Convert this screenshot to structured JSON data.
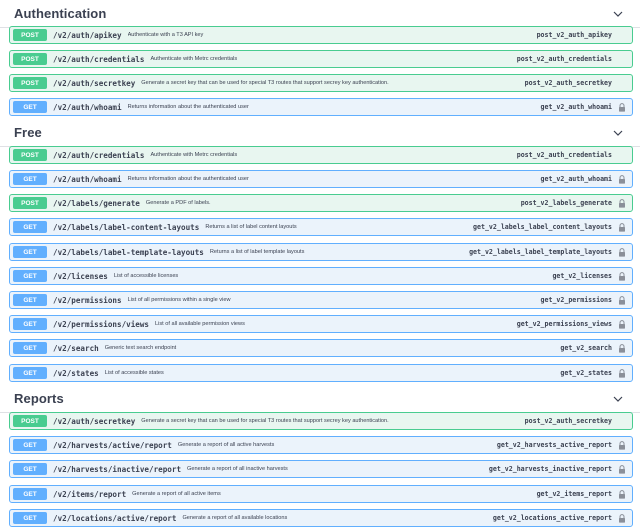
{
  "sections": [
    {
      "title": "Authentication",
      "operations": [
        {
          "method": "POST",
          "path": "/v2/auth/apikey",
          "summary": "Authenticate with a T3 API key",
          "operation_id": "post_v2_auth_apikey",
          "locked": false
        },
        {
          "method": "POST",
          "path": "/v2/auth/credentials",
          "summary": "Authenticate with Metrc credentials",
          "operation_id": "post_v2_auth_credentials",
          "locked": false
        },
        {
          "method": "POST",
          "path": "/v2/auth/secretkey",
          "summary": "Generate a secret key that can be used for special T3 routes that support secrey key authentication.",
          "operation_id": "post_v2_auth_secretkey",
          "locked": false
        },
        {
          "method": "GET",
          "path": "/v2/auth/whoami",
          "summary": "Returns information about the authenticated user",
          "operation_id": "get_v2_auth_whoami",
          "locked": true
        }
      ]
    },
    {
      "title": "Free",
      "operations": [
        {
          "method": "POST",
          "path": "/v2/auth/credentials",
          "summary": "Authenticate with Metrc credentials",
          "operation_id": "post_v2_auth_credentials",
          "locked": false
        },
        {
          "method": "GET",
          "path": "/v2/auth/whoami",
          "summary": "Returns information about the authenticated user",
          "operation_id": "get_v2_auth_whoami",
          "locked": true
        },
        {
          "method": "POST",
          "path": "/v2/labels/generate",
          "summary": "Generate a PDF of labels.",
          "operation_id": "post_v2_labels_generate",
          "locked": true
        },
        {
          "method": "GET",
          "path": "/v2/labels/label-content-layouts",
          "summary": "Returns a list of label content layouts",
          "operation_id": "get_v2_labels_label_content_layouts",
          "locked": true
        },
        {
          "method": "GET",
          "path": "/v2/labels/label-template-layouts",
          "summary": "Returns a list of label template layouts",
          "operation_id": "get_v2_labels_label_template_layouts",
          "locked": true
        },
        {
          "method": "GET",
          "path": "/v2/licenses",
          "summary": "List of accessible licenses",
          "operation_id": "get_v2_licenses",
          "locked": true
        },
        {
          "method": "GET",
          "path": "/v2/permissions",
          "summary": "List of all permissions within a single view",
          "operation_id": "get_v2_permissions",
          "locked": true
        },
        {
          "method": "GET",
          "path": "/v2/permissions/views",
          "summary": "List of all available permission views",
          "operation_id": "get_v2_permissions_views",
          "locked": true
        },
        {
          "method": "GET",
          "path": "/v2/search",
          "summary": "Generic text search endpoint",
          "operation_id": "get_v2_search",
          "locked": true
        },
        {
          "method": "GET",
          "path": "/v2/states",
          "summary": "List of accessible states",
          "operation_id": "get_v2_states",
          "locked": true
        }
      ]
    },
    {
      "title": "Reports",
      "operations": [
        {
          "method": "POST",
          "path": "/v2/auth/secretkey",
          "summary": "Generate a secret key that can be used for special T3 routes that support secrey key authentication.",
          "operation_id": "post_v2_auth_secretkey",
          "locked": false
        },
        {
          "method": "GET",
          "path": "/v2/harvests/active/report",
          "summary": "Generate a report of all active harvests",
          "operation_id": "get_v2_harvests_active_report",
          "locked": true
        },
        {
          "method": "GET",
          "path": "/v2/harvests/inactive/report",
          "summary": "Generate a report of all inactive harvests",
          "operation_id": "get_v2_harvests_inactive_report",
          "locked": true
        },
        {
          "method": "GET",
          "path": "/v2/items/report",
          "summary": "Generate a report of all active items",
          "operation_id": "get_v2_items_report",
          "locked": true
        },
        {
          "method": "GET",
          "path": "/v2/locations/active/report",
          "summary": "Generate a report of all available locations",
          "operation_id": "get_v2_locations_active_report",
          "locked": true
        }
      ]
    }
  ],
  "colors": {
    "post": "#49cc90",
    "get": "#61affe"
  },
  "icons": {
    "section_toggle": "chevron-down-icon",
    "auth": "lock-icon"
  }
}
